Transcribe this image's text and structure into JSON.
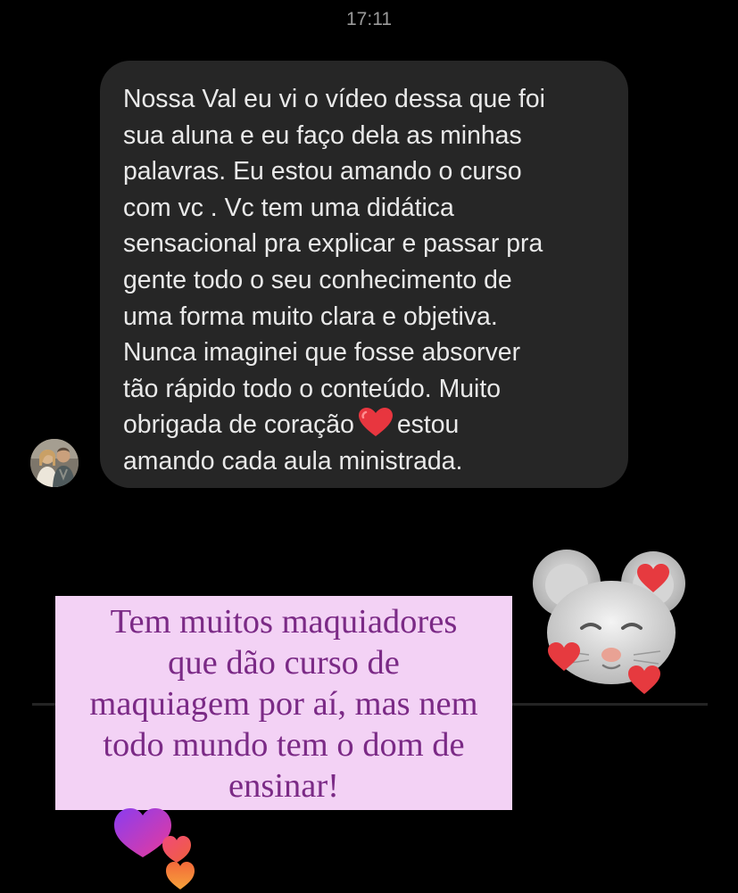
{
  "status_bar": {
    "time": "17:11"
  },
  "message": {
    "lines": [
      "Nossa Val eu vi o vídeo dessa que foi",
      "sua aluna e eu faço dela as minhas",
      "palavras. Eu estou amando o curso",
      "com vc . Vc tem uma didática",
      "sensacional pra explicar e passar pra",
      "gente todo o seu conhecimento de",
      "uma forma muito clara e objetiva.",
      "Nunca imaginei que fosse absorver",
      "tão rápido todo o conteúdo. Muito",
      "obrigada de coração",
      "estou",
      "amando cada aula ministrada."
    ],
    "emoji_icon": "red-heart-icon",
    "bubble_color": "#262626",
    "text_color": "#e9e9e9"
  },
  "sender": {
    "avatar_icon": "profile-photo-avatar"
  },
  "story_caption": {
    "lines": [
      "Tem muitos maquiadores",
      "que dão curso de",
      "maquiagem por aí, mas nem",
      "todo mundo tem o dom de",
      "ensinar!"
    ],
    "background_color": "#f3d2f5",
    "text_color": "#7b2a86"
  },
  "stickers": {
    "mouse_sticker": "mouse-memoji-hearts-sticker",
    "hearts_sticker": "gradient-hearts-sticker"
  }
}
